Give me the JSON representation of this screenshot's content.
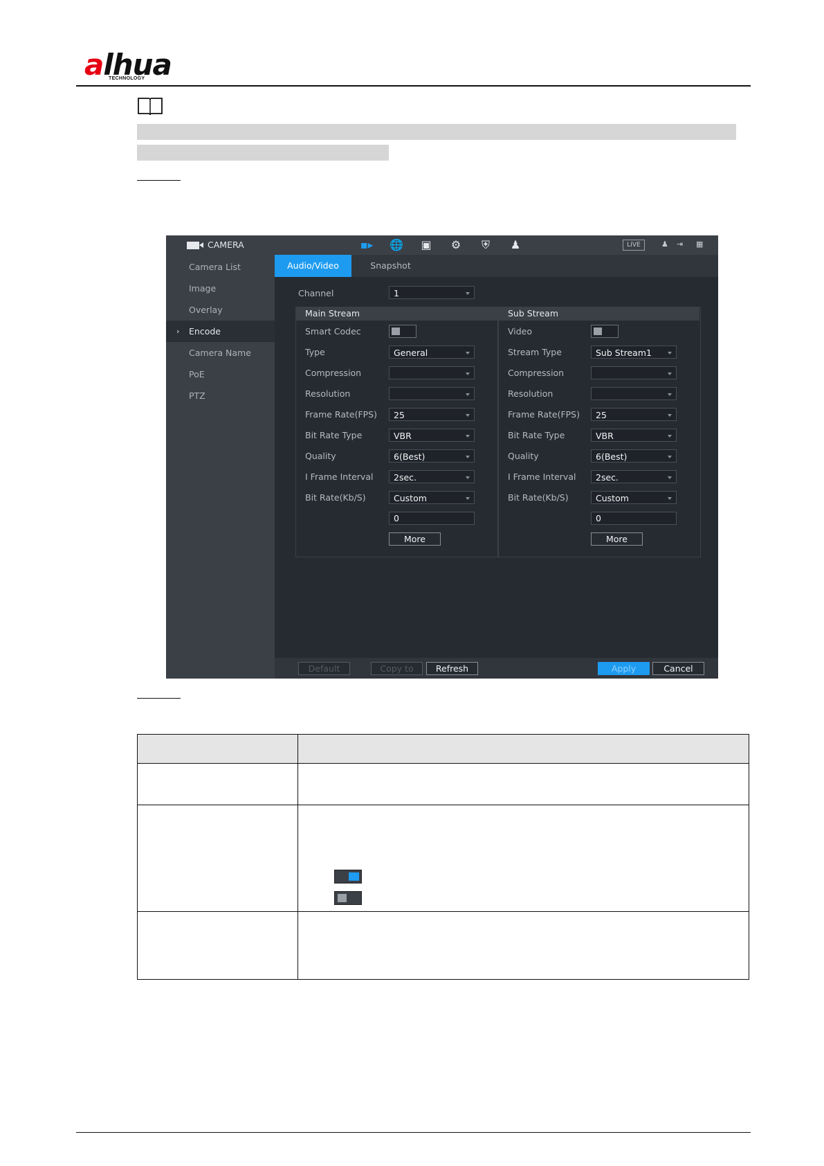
{
  "header": {
    "logo_text": "alhua",
    "logo_subtext": "TECHNOLOGY"
  },
  "app": {
    "section_title": "CAMERA",
    "live_badge": "LIVE",
    "toolbar_icons": [
      "camera-icon",
      "network-icon",
      "storage-icon",
      "system-icon",
      "security-icon",
      "account-icon"
    ],
    "sidebar": {
      "items": [
        {
          "label": "Camera List",
          "active": false
        },
        {
          "label": "Image",
          "active": false
        },
        {
          "label": "Overlay",
          "active": false
        },
        {
          "label": "Encode",
          "active": true
        },
        {
          "label": "Camera Name",
          "active": false
        },
        {
          "label": "PoE",
          "active": false
        },
        {
          "label": "PTZ",
          "active": false
        }
      ]
    },
    "tabs": [
      {
        "label": "Audio/Video",
        "active": true
      },
      {
        "label": "Snapshot",
        "active": false
      }
    ],
    "channel": {
      "label": "Channel",
      "value": "1"
    },
    "main_stream": {
      "title": "Main Stream",
      "smart_codec_label": "Smart Codec",
      "smart_codec_on": false,
      "rows": [
        {
          "label": "Type",
          "value": "General"
        },
        {
          "label": "Compression",
          "value": ""
        },
        {
          "label": "Resolution",
          "value": ""
        },
        {
          "label": "Frame Rate(FPS)",
          "value": "25"
        },
        {
          "label": "Bit Rate Type",
          "value": "VBR"
        },
        {
          "label": "Quality",
          "value": "6(Best)"
        },
        {
          "label": "I Frame Interval",
          "value": "2sec."
        },
        {
          "label": "Bit Rate(Kb/S)",
          "value": "Custom"
        }
      ],
      "bitrate_value": "0",
      "more_label": "More"
    },
    "sub_stream": {
      "title": "Sub Stream",
      "video_label": "Video",
      "video_on": false,
      "rows": [
        {
          "label": "Stream Type",
          "value": "Sub Stream1"
        },
        {
          "label": "Compression",
          "value": ""
        },
        {
          "label": "Resolution",
          "value": ""
        },
        {
          "label": "Frame Rate(FPS)",
          "value": "25"
        },
        {
          "label": "Bit Rate Type",
          "value": "VBR"
        },
        {
          "label": "Quality",
          "value": "6(Best)"
        },
        {
          "label": "I Frame Interval",
          "value": "2sec."
        },
        {
          "label": "Bit Rate(Kb/S)",
          "value": "Custom"
        }
      ],
      "bitrate_value": "0",
      "more_label": "More"
    },
    "footer": {
      "default_label": "Default",
      "copy_label": "Copy to",
      "refresh_label": "Refresh",
      "apply_label": "Apply",
      "cancel_label": "Cancel"
    }
  },
  "table_toggles": {
    "on_color": "#1d9bf0",
    "off_color": "#9aa0a8"
  }
}
